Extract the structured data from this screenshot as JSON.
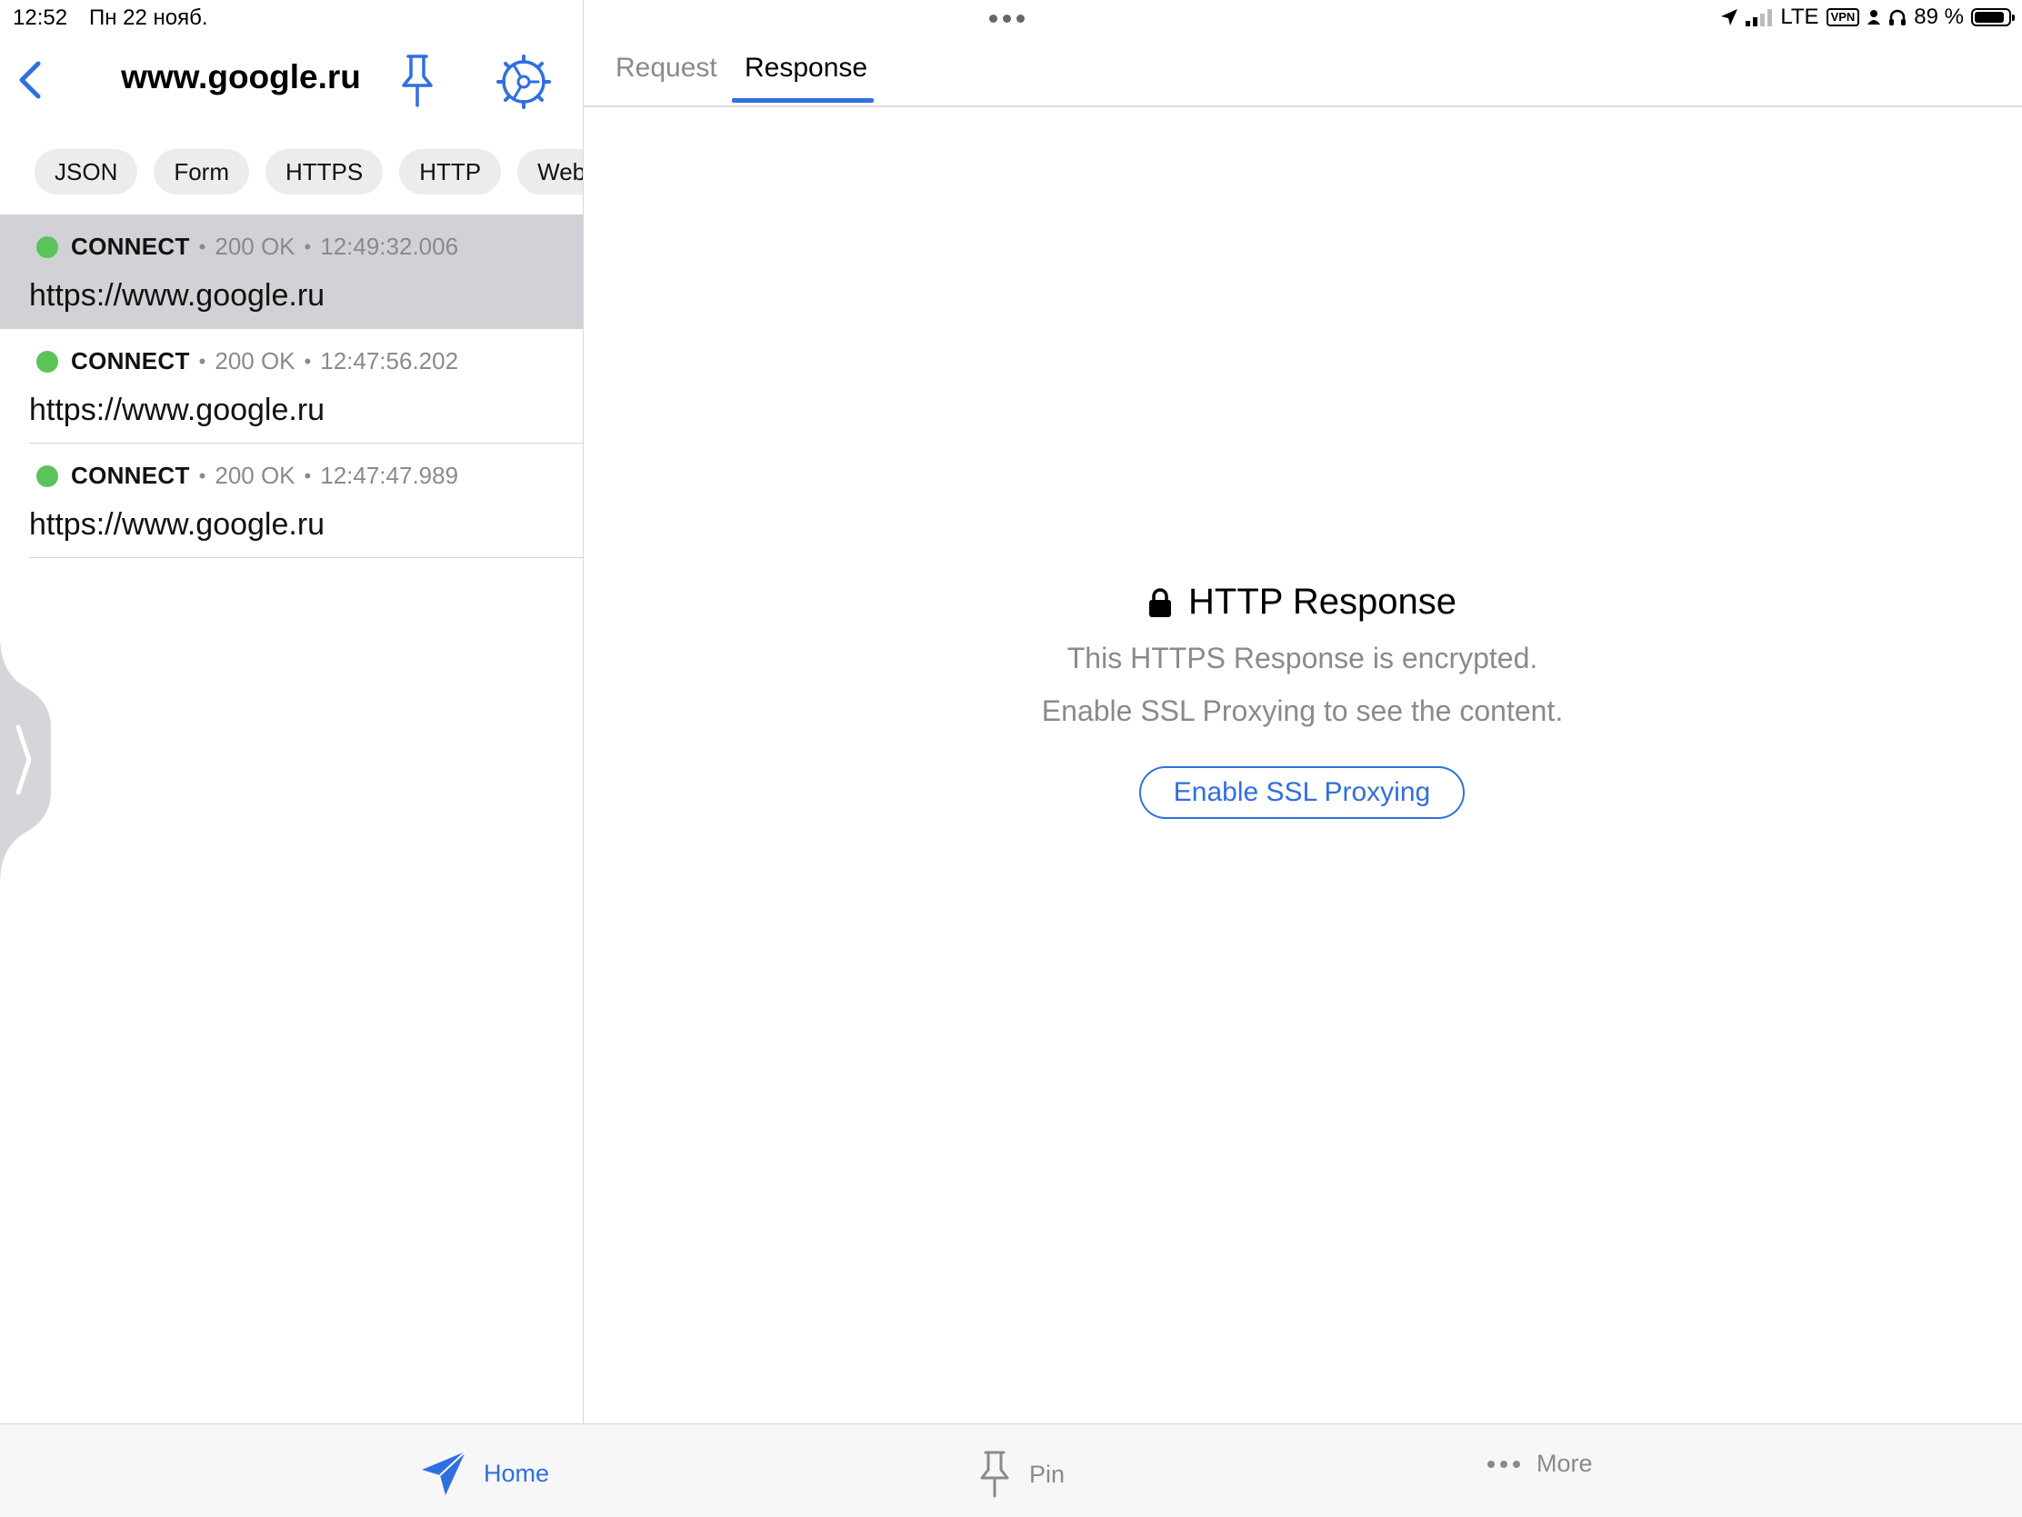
{
  "status_bar": {
    "time": "12:52",
    "date": "Пн 22 нояб.",
    "network": "LTE",
    "vpn": "VPN",
    "battery": "89 %",
    "battery_level": 0.89
  },
  "nav": {
    "title": "www.google.ru"
  },
  "filters": [
    "JSON",
    "Form",
    "HTTPS",
    "HTTP",
    "Websocket"
  ],
  "requests": [
    {
      "method": "CONNECT",
      "status": "200 OK",
      "time": "12:49:32.006",
      "url": "https://www.google.ru",
      "selected": true
    },
    {
      "method": "CONNECT",
      "status": "200 OK",
      "time": "12:47:56.202",
      "url": "https://www.google.ru",
      "selected": false
    },
    {
      "method": "CONNECT",
      "status": "200 OK",
      "time": "12:47:47.989",
      "url": "https://www.google.ru",
      "selected": false
    }
  ],
  "detail": {
    "tabs": {
      "request": "Request",
      "response": "Response"
    },
    "empty_title": "HTTP Response",
    "empty_line1": "This HTTPS Response is encrypted.",
    "empty_line2": "Enable SSL Proxying to see the content.",
    "button": "Enable SSL Proxying"
  },
  "tabbar": {
    "home": "Home",
    "pin": "Pin",
    "more": "More"
  },
  "colors": {
    "accent": "#2f6fe0",
    "success": "#5ac45a",
    "selected_row": "#d1d1d6"
  }
}
